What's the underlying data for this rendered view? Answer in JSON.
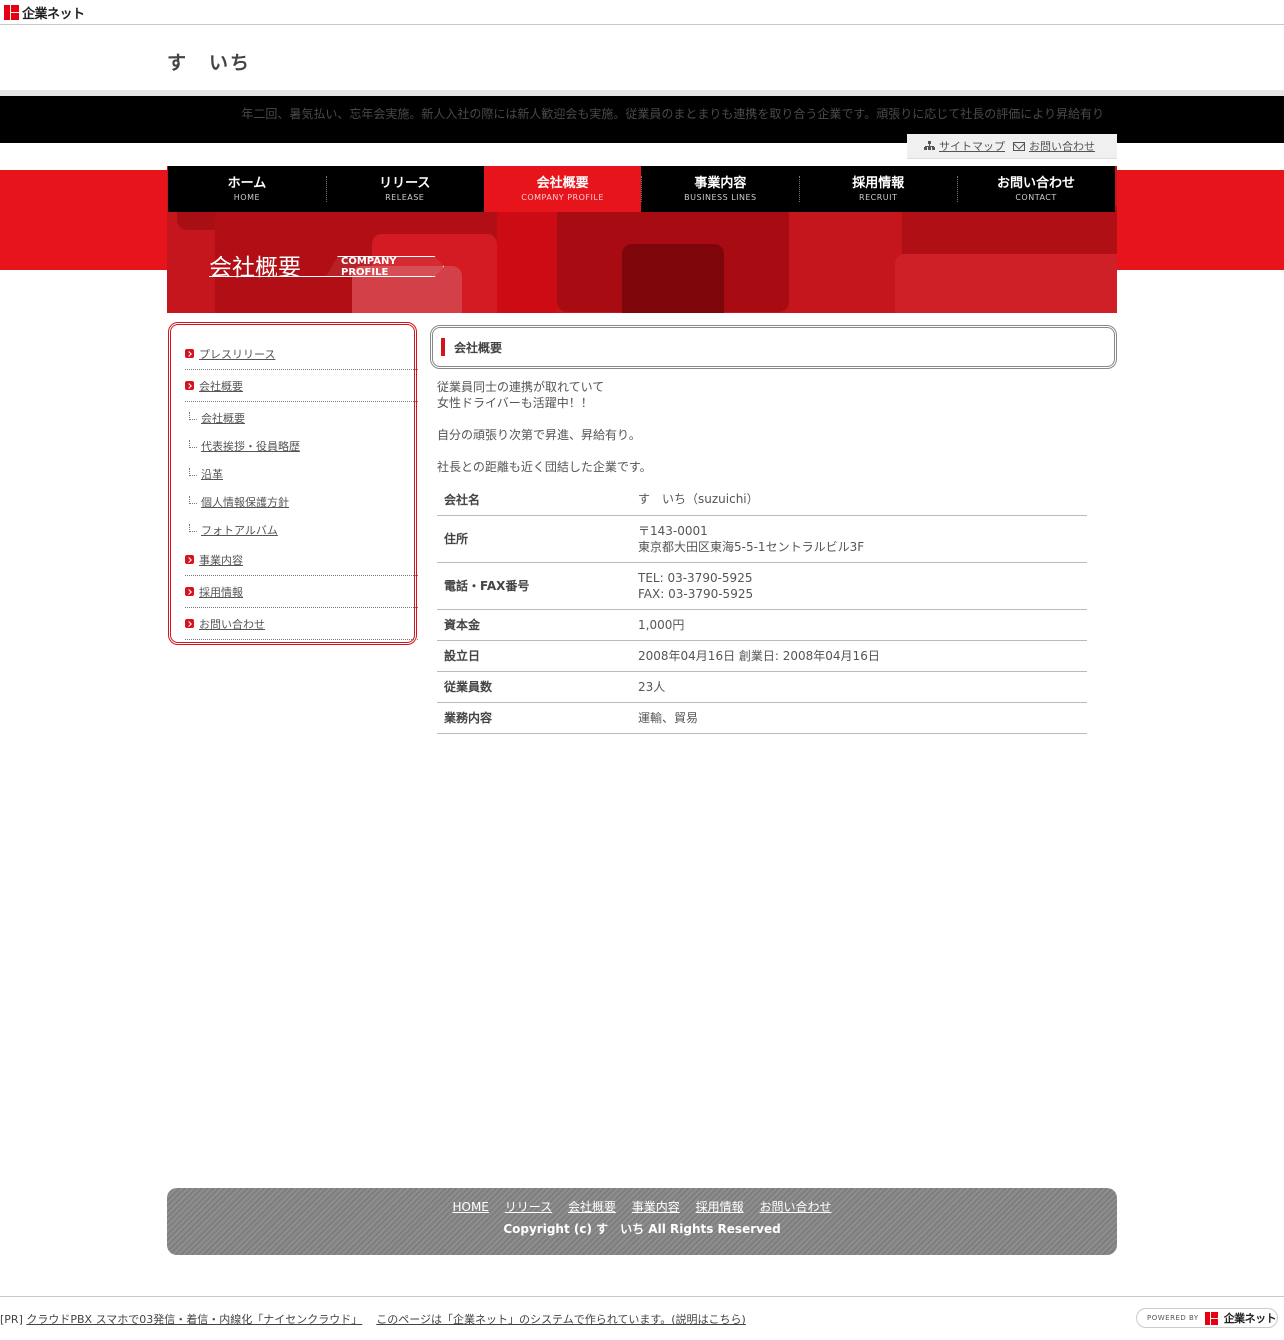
{
  "brand": {
    "name": "企業ネット"
  },
  "site": {
    "title": "す　いち"
  },
  "header": {
    "tagline": "年二回、暑気払い、忘年会実施。新人入社の際には新人歓迎会も実施。従業員のまとまりも連携を取り合う企業です。頑張りに応じて社長の評価により昇給有り",
    "sitemap": "サイトマップ",
    "contact": "お問い合わせ"
  },
  "nav": [
    {
      "jp": "ホーム",
      "en": "HOME"
    },
    {
      "jp": "リリース",
      "en": "RELEASE"
    },
    {
      "jp": "会社概要",
      "en": "COMPANY PROFILE"
    },
    {
      "jp": "事業内容",
      "en": "BUSINESS LINES"
    },
    {
      "jp": "採用情報",
      "en": "RECRUIT"
    },
    {
      "jp": "お問い合わせ",
      "en": "CONTACT"
    }
  ],
  "hero": {
    "title": "会社概要",
    "tag": "COMPANY PROFILE"
  },
  "sidebar": {
    "items": [
      {
        "label": "プレスリリース"
      },
      {
        "label": "会社概要"
      },
      {
        "label": "会社概要"
      },
      {
        "label": "代表挨拶・役員略歴"
      },
      {
        "label": "沿革"
      },
      {
        "label": "個人情報保護方針"
      },
      {
        "label": "フォトアルバム"
      },
      {
        "label": "事業内容"
      },
      {
        "label": "採用情報"
      },
      {
        "label": "お問い合わせ"
      }
    ]
  },
  "main": {
    "heading": "会社概要",
    "intro": [
      "従業員同士の連携が取れていて",
      "女性ドライバーも活躍中！！",
      "",
      "自分の頑張り次第で昇進、昇給有り。",
      "",
      "社長との距離も近く団結した企業です。"
    ],
    "table": [
      {
        "label": "会社名",
        "lines": [
          "す　いち（suzuichi）"
        ]
      },
      {
        "label": "住所",
        "lines": [
          "〒143-0001",
          "東京都大田区東海5-5-1セントラルビル3F"
        ]
      },
      {
        "label": "電話・FAX番号",
        "lines": [
          "TEL: 03-3790-5925",
          "FAX: 03-3790-5925"
        ]
      },
      {
        "label": "資本金",
        "lines": [
          "1,000円"
        ]
      },
      {
        "label": "設立日",
        "lines": [
          "2008年04月16日 創業日: 2008年04月16日"
        ]
      },
      {
        "label": "従業員数",
        "lines": [
          "23人"
        ]
      },
      {
        "label": "業務内容",
        "lines": [
          "運輸、貿易"
        ]
      }
    ]
  },
  "footer": {
    "links": [
      "HOME",
      "リリース",
      "会社概要",
      "事業内容",
      "採用情報",
      "お問い合わせ"
    ],
    "copyright": "Copyright (c) す　いち All Rights Reserved"
  },
  "bottom": {
    "pr_prefix": "[PR]",
    "pr_link": "クラウドPBX スマホで03発信・着信・内線化「ナイセンクラウド」",
    "system_link": "このページは「企業ネット」のシステムで作られています。(説明はこちら)",
    "powered": "POWERED BY"
  }
}
